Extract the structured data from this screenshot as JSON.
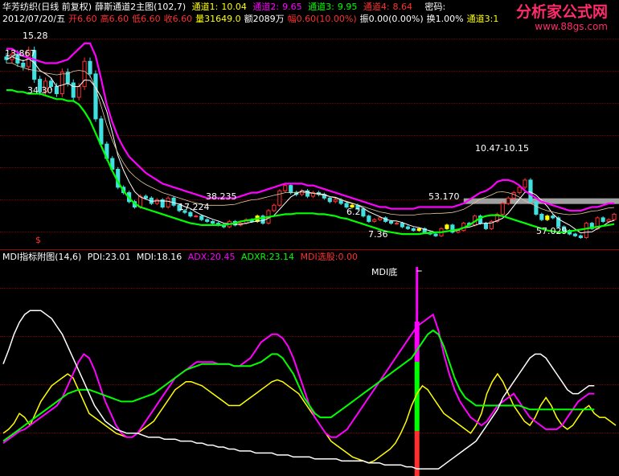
{
  "header": {
    "stock": "华芳纺织(日线 前复权)",
    "indicator": "薛斯通道2主图(102,7)",
    "ch1_label": "通道1:",
    "ch1_value": "10.04",
    "ch2_label": "通道2:",
    "ch2_value": "9.65",
    "ch3_label": "通道3:",
    "ch3_value": "9.95",
    "ch4_label": "通道4:",
    "ch4_value": "8.64",
    "code_label": "密码:"
  },
  "quote": {
    "date": "2012/07/20/五",
    "open_label": "开",
    "open": "6.60",
    "high_label": "高",
    "high": "6.60",
    "low_label": "低",
    "low": "6.60",
    "close_label": "收",
    "close": "6.60",
    "vol_label": "量",
    "volume": "31649.0",
    "amt_label": "额",
    "amount": "2089万",
    "chg_label": "幅",
    "change": "0.60(10.00%)",
    "amp_label": "振",
    "amplitude": "0.00(0.00%)",
    "turn_label": "换",
    "turnover": "1.00%",
    "extra": "通道3:1"
  },
  "brand": {
    "name": "分析家公式网",
    "url": "www.88gs.com"
  },
  "price_labels": {
    "hi1": "15.28",
    "l2": "13.867",
    "l3": "34.30",
    "l4": "38.235",
    "l5": "17.224",
    "l6": "6.2",
    "l7": "7.36",
    "l8": "53.170",
    "l9": "10.47-10.15",
    "l10": "57.029",
    "bottom_marker": "$"
  },
  "sub_header": {
    "name": "MDI指标附图(14,6)",
    "pdi_label": "PDI:",
    "pdi": "23.01",
    "mdi_label": "MDI:",
    "mdi": "18.16",
    "adx_label": "ADX:",
    "adx": "20.45",
    "adxr_label": "ADXR:",
    "adxr": "23.14",
    "sel_label": "MDI选股:",
    "sel": "0.00"
  },
  "mdi_marker": "MDI底",
  "colors": {
    "up": "#ff3030",
    "down": "#40e0e0",
    "yellow": "#ffff00",
    "channel_top": "#ff00ff",
    "channel_bottom": "#00ff00",
    "white": "#ffffff",
    "grid": "#7a0000",
    "band": "#a0a0a0"
  },
  "chart_data": [
    {
      "type": "candlestick",
      "title": "华芳纺织(日线 前复权)",
      "n_bars": 110,
      "close": [
        14.3,
        14.6,
        14.1,
        13.9,
        14.8,
        13.2,
        12.5,
        13.1,
        12.8,
        12.4,
        13.6,
        13.0,
        12.2,
        12.8,
        14.2,
        13.5,
        11.0,
        9.6,
        8.8,
        8.2,
        7.2,
        6.9,
        6.4,
        6.1,
        6.7,
        6.6,
        6.3,
        6.5,
        6.1,
        6.6,
        6.2,
        5.9,
        5.8,
        5.6,
        5.6,
        5.4,
        5.3,
        5.2,
        5.1,
        5.0,
        5.3,
        5.1,
        5.2,
        5.4,
        5.3,
        5.6,
        5.2,
        5.9,
        6.2,
        7.0,
        7.3,
        6.9,
        6.8,
        7.0,
        6.7,
        6.9,
        6.8,
        6.6,
        6.4,
        6.5,
        6.3,
        6.1,
        6.2,
        6.0,
        5.6,
        5.3,
        5.4,
        5.5,
        5.3,
        5.2,
        5.2,
        5.0,
        4.9,
        4.8,
        4.9,
        4.7,
        4.6,
        4.5,
        4.9,
        5.1,
        4.7,
        4.8,
        5.2,
        5.1,
        5.6,
        5.2,
        4.9,
        5.3,
        5.7,
        6.3,
        6.6,
        6.9,
        7.2,
        7.6,
        6.4,
        5.7,
        5.4,
        5.6,
        5.5,
        5.0,
        4.8,
        4.6,
        4.5,
        4.4,
        5.2,
        4.9,
        5.5,
        5.3,
        5.4,
        5.7
      ],
      "upper": [
        14.9,
        14.9,
        14.7,
        14.5,
        14.4,
        14.3,
        14.2,
        14.1,
        14.1,
        14.1,
        14.2,
        14.3,
        14.6,
        14.9,
        15.2,
        15.2,
        14.5,
        13.2,
        11.8,
        10.8,
        10.0,
        9.4,
        8.9,
        8.6,
        8.3,
        8.0,
        7.8,
        7.6,
        7.4,
        7.3,
        7.2,
        7.1,
        7.0,
        6.9,
        6.8,
        6.7,
        6.6,
        6.6,
        6.6,
        6.6,
        6.6,
        6.6,
        6.7,
        6.8,
        6.9,
        6.9,
        7.0,
        7.1,
        7.2,
        7.3,
        7.4,
        7.4,
        7.4,
        7.4,
        7.3,
        7.3,
        7.2,
        7.1,
        7.0,
        6.9,
        6.8,
        6.7,
        6.6,
        6.5,
        6.4,
        6.3,
        6.2,
        6.1,
        6.1,
        6.0,
        6.0,
        6.0,
        6.0,
        6.0,
        6.1,
        6.1,
        6.1,
        6.1,
        6.1,
        6.1,
        6.1,
        6.2,
        6.3,
        6.5,
        6.7,
        6.9,
        7.0,
        7.2,
        7.5,
        7.6,
        7.6,
        7.5,
        7.3,
        7.0,
        6.8,
        6.6,
        6.4,
        6.3,
        6.2,
        6.1,
        6.0,
        5.9,
        5.9,
        5.9,
        6.0,
        6.1,
        6.1,
        6.2,
        6.3,
        6.3
      ],
      "lower": [
        12.6,
        12.6,
        12.5,
        12.5,
        12.4,
        12.4,
        12.4,
        12.3,
        12.2,
        12.1,
        12.1,
        12.0,
        12.0,
        11.8,
        11.4,
        10.9,
        10.2,
        9.5,
        8.8,
        8.1,
        7.5,
        7.0,
        6.6,
        6.3,
        6.1,
        6.0,
        5.9,
        5.8,
        5.7,
        5.6,
        5.5,
        5.4,
        5.3,
        5.2,
        5.15,
        5.1,
        5.1,
        5.1,
        5.1,
        5.1,
        5.15,
        5.2,
        5.3,
        5.35,
        5.4,
        5.45,
        5.5,
        5.55,
        5.6,
        5.65,
        5.7,
        5.7,
        5.75,
        5.75,
        5.75,
        5.75,
        5.7,
        5.7,
        5.65,
        5.6,
        5.5,
        5.45,
        5.35,
        5.25,
        5.15,
        5.05,
        4.95,
        4.85,
        4.75,
        4.7,
        4.65,
        4.6,
        4.6,
        4.6,
        4.6,
        4.65,
        4.65,
        4.7,
        4.7,
        4.75,
        4.8,
        4.85,
        4.95,
        5.1,
        5.3,
        5.5,
        5.6,
        5.65,
        5.65,
        5.6,
        5.5,
        5.4,
        5.3,
        5.2,
        5.1,
        5.0,
        4.9,
        4.8,
        4.75,
        4.7,
        4.7,
        4.75,
        4.8,
        4.85,
        4.9,
        4.95,
        5.0,
        5.05,
        5.1,
        5.15
      ],
      "band_y": 6.45,
      "ylim": [
        4.2,
        16.0
      ]
    },
    {
      "type": "line",
      "title": "MDI指标附图(14,6)",
      "series": [
        {
          "name": "PDI",
          "values": [
            20,
            22,
            25,
            30,
            28,
            24,
            30,
            36,
            40,
            44,
            46,
            48,
            50,
            48,
            42,
            36,
            30,
            28,
            26,
            24,
            22,
            20,
            19,
            18,
            18,
            20,
            22,
            24,
            26,
            30,
            34,
            38,
            42,
            44,
            46,
            46,
            45,
            44,
            42,
            40,
            38,
            36,
            34,
            34,
            34,
            36,
            38,
            40,
            42,
            44,
            46,
            47,
            46,
            44,
            42,
            40,
            36,
            32,
            28,
            24,
            20,
            16,
            14,
            12,
            10,
            8,
            7,
            6,
            5,
            6,
            8,
            10,
            12,
            15,
            20,
            26,
            34,
            40,
            44,
            42,
            38,
            34,
            30,
            28,
            26,
            24,
            22,
            20,
            24,
            30,
            40,
            46,
            50,
            46,
            40,
            34,
            30,
            26,
            24,
            28,
            34,
            38,
            34,
            28,
            24,
            22,
            24,
            28,
            32,
            34,
            30,
            28,
            28,
            26,
            24
          ]
        },
        {
          "name": "MDI",
          "values": [
            15,
            17,
            19,
            21,
            22,
            24,
            26,
            28,
            30,
            32,
            34,
            38,
            44,
            50,
            56,
            60,
            58,
            52,
            44,
            36,
            30,
            24,
            20,
            18,
            18,
            20,
            24,
            28,
            32,
            36,
            40,
            44,
            48,
            50,
            52,
            54,
            56,
            56,
            56,
            56,
            55,
            55,
            55,
            54,
            54,
            56,
            58,
            62,
            66,
            68,
            70,
            70,
            68,
            64,
            58,
            50,
            42,
            34,
            28,
            24,
            20,
            18,
            18,
            20,
            22,
            26,
            30,
            34,
            38,
            42,
            46,
            50,
            54,
            58,
            62,
            66,
            70,
            74,
            76,
            78,
            80,
            72,
            60,
            50,
            42,
            36,
            32,
            28,
            26,
            24,
            26,
            30,
            34,
            36,
            38,
            40,
            36,
            32,
            28,
            26,
            24,
            22,
            22,
            22,
            24,
            28,
            32,
            36,
            38,
            40,
            40
          ]
        },
        {
          "name": "ADX",
          "values": [
            16,
            18,
            20,
            22,
            24,
            26,
            28,
            30,
            32,
            34,
            36,
            38,
            40,
            41,
            42,
            42,
            42,
            41,
            40,
            39,
            38,
            37,
            36,
            36,
            36,
            37,
            38,
            39,
            40,
            42,
            44,
            46,
            48,
            50,
            52,
            53,
            54,
            55,
            55,
            55,
            55,
            55,
            55,
            54,
            54,
            54,
            54,
            55,
            56,
            58,
            60,
            60,
            58,
            54,
            50,
            44,
            38,
            34,
            30,
            28,
            28,
            28,
            30,
            32,
            34,
            36,
            38,
            40,
            42,
            44,
            46,
            48,
            50,
            52,
            54,
            56,
            58,
            62,
            66,
            70,
            72,
            70,
            64,
            56,
            48,
            42,
            38,
            36,
            34,
            34,
            34,
            34,
            34,
            34,
            34,
            34,
            34,
            33,
            32,
            32,
            32,
            32,
            32,
            32,
            32,
            32,
            32,
            32,
            32,
            32,
            32
          ]
        },
        {
          "name": "ADXR",
          "values": [
            55,
            62,
            70,
            76,
            80,
            82,
            82,
            82,
            80,
            78,
            74,
            70,
            64,
            58,
            52,
            46,
            40,
            34,
            30,
            26,
            24,
            22,
            21,
            20,
            20,
            20,
            19,
            18,
            18,
            18,
            17,
            17,
            17,
            16,
            16,
            16,
            15,
            15,
            14,
            14,
            13,
            13,
            12,
            12,
            11,
            11,
            11,
            10,
            10,
            10,
            10,
            9,
            9,
            9,
            8,
            8,
            8,
            8,
            7,
            7,
            7,
            7,
            7,
            6,
            6,
            6,
            6,
            6,
            5,
            5,
            5,
            4,
            4,
            4,
            4,
            3,
            3,
            2,
            2,
            2,
            2,
            2,
            4,
            6,
            8,
            10,
            12,
            14,
            16,
            20,
            24,
            28,
            32,
            38,
            42,
            46,
            50,
            54,
            58,
            60,
            60,
            58,
            54,
            50,
            46,
            42,
            40,
            40,
            42,
            44,
            44
          ]
        }
      ],
      "marker_index": 77,
      "marker_label": "MDI底",
      "ylim": [
        0,
        100
      ]
    }
  ]
}
